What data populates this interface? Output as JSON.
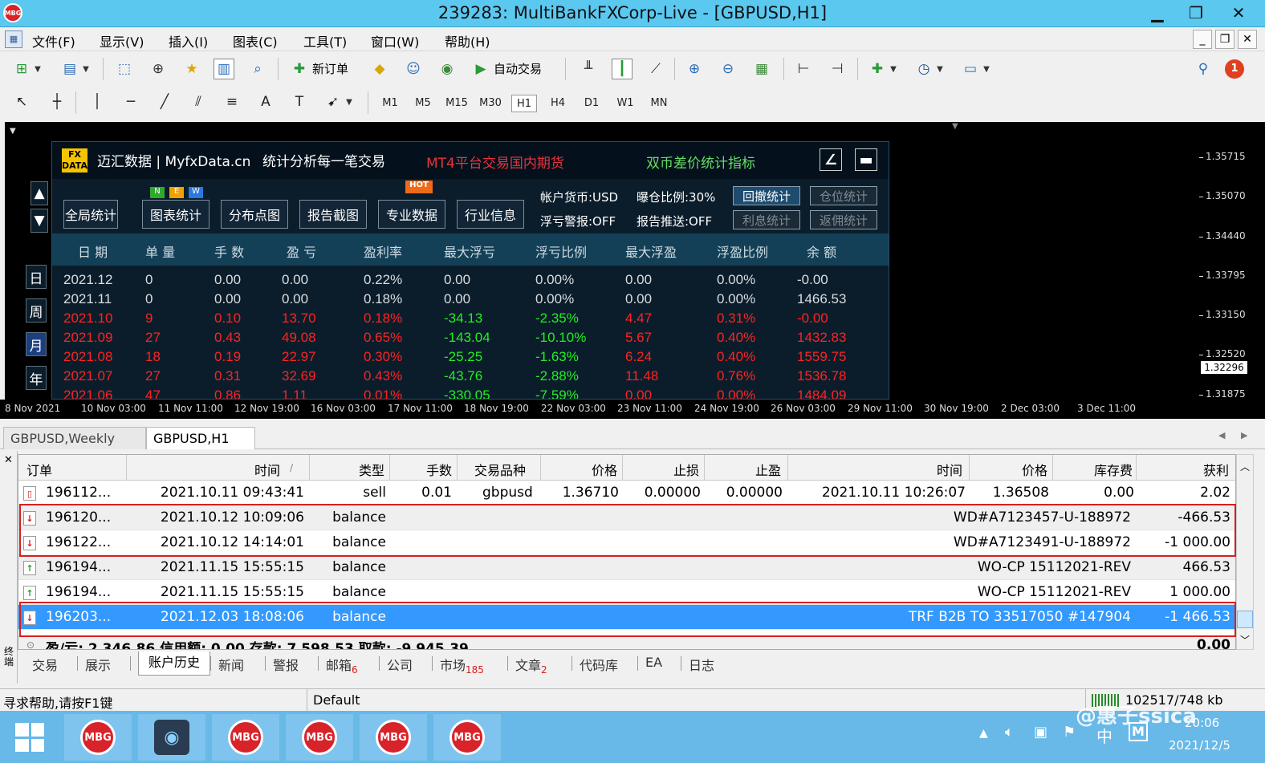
{
  "window": {
    "title": "239283: MultiBankFXCorp-Live - [GBPUSD,H1]",
    "logo_text": "MBG",
    "minimize": "▁",
    "restore": "❐",
    "close": "✕"
  },
  "menu": [
    "文件(F)",
    "显示(V)",
    "插入(I)",
    "图表(C)",
    "工具(T)",
    "窗口(W)",
    "帮助(H)"
  ],
  "mdi": {
    "minimize": "_",
    "restore": "❐",
    "close": "✕"
  },
  "toolbar": {
    "new_order": "新订单",
    "auto_trading": "自动交易",
    "notification_count": "1",
    "text_tool": "A",
    "timeframes": [
      "M1",
      "M5",
      "M15",
      "M30",
      "H1",
      "H4",
      "D1",
      "W1",
      "MN"
    ],
    "active_timeframe": "H1"
  },
  "chart": {
    "prices": [
      "1.35715",
      "1.35070",
      "1.34440",
      "1.33795",
      "1.33150",
      "1.32520",
      "1.32296",
      "1.31875"
    ],
    "current_price": "1.32296",
    "times": [
      "8 Nov 2021",
      "10 Nov 03:00",
      "11 Nov 11:00",
      "12 Nov 19:00",
      "16 Nov 03:00",
      "17 Nov 11:00",
      "18 Nov 19:00",
      "22 Nov 03:00",
      "23 Nov 11:00",
      "24 Nov 19:00",
      "26 Nov 03:00",
      "29 Nov 11:00",
      "30 Nov 19:00",
      "2 Dec 03:00",
      "3 Dec 11:00"
    ]
  },
  "panel": {
    "logo": "FX DATA",
    "brand": "迈汇数据 | MyfxData.cn",
    "slogan": "统计分析每一笔交易",
    "promo": "MT4平台交易国内期货",
    "indicator": "双币差价统计指标",
    "new_badge": [
      "N",
      "E",
      "W"
    ],
    "hot_badge": "HOT",
    "nav": [
      "全局统计",
      "图表统计",
      "分布点图",
      "报告截图",
      "专业数据",
      "行业信息"
    ],
    "settings": {
      "currency": "帐户货币:USD",
      "ratio": "曝仓比例:30%",
      "float_alert": "浮亏警报:OFF",
      "report_push": "报告推送:OFF"
    },
    "right_buttons": [
      "回撤统计",
      "仓位统计",
      "利息统计",
      "返佣统计"
    ],
    "side_buttons": [
      "日",
      "周",
      "月",
      "年"
    ],
    "columns": [
      "日 期",
      "单 量",
      "手 数",
      "盈 亏",
      "盈利率",
      "最大浮亏",
      "浮亏比例",
      "最大浮盈",
      "浮盈比例",
      "余 额"
    ],
    "rows": [
      [
        "2021.12",
        "0",
        "0.00",
        "0.00",
        "0.22%",
        "0.00",
        "0.00%",
        "0.00",
        "0.00%",
        "-0.00"
      ],
      [
        "2021.11",
        "0",
        "0.00",
        "0.00",
        "0.18%",
        "0.00",
        "0.00%",
        "0.00",
        "0.00%",
        "1466.53"
      ],
      [
        "2021.10",
        "9",
        "0.10",
        "13.70",
        "0.18%",
        "-34.13",
        "-2.35%",
        "4.47",
        "0.31%",
        "-0.00"
      ],
      [
        "2021.09",
        "27",
        "0.43",
        "49.08",
        "0.65%",
        "-143.04",
        "-10.10%",
        "5.67",
        "0.40%",
        "1432.83"
      ],
      [
        "2021.08",
        "18",
        "0.19",
        "22.97",
        "0.30%",
        "-25.25",
        "-1.63%",
        "6.24",
        "0.40%",
        "1559.75"
      ],
      [
        "2021.07",
        "27",
        "0.31",
        "32.69",
        "0.43%",
        "-43.76",
        "-2.88%",
        "11.48",
        "0.76%",
        "1536.78"
      ],
      [
        "2021.06",
        "47",
        "0.86",
        "1.11",
        "0.01%",
        "-330.05",
        "-7.59%",
        "0.00",
        "0.00%",
        "1484.09"
      ]
    ],
    "colors": {
      "row_white": "#d9dde0",
      "row_red": "#ff2222",
      "row_green": "#22ee22",
      "promo": "#e8333a",
      "indicator": "#66dd66"
    }
  },
  "chart_tabs": [
    "GBPUSD,Weekly",
    "GBPUSD,H1"
  ],
  "history": {
    "columns": [
      "订单",
      "时间",
      "类型",
      "手数",
      "交易品种",
      "价格",
      "止损",
      "止盈",
      "时间",
      "价格",
      "库存费",
      "获利"
    ],
    "sort_mark": "/",
    "trade": [
      "196112...",
      "2021.10.11 09:43:41",
      "sell",
      "0.01",
      "gbpusd",
      "1.36710",
      "0.00000",
      "0.00000",
      "2021.10.11 10:26:07",
      "1.36508",
      "0.00",
      "2.02"
    ],
    "balance_rows": [
      {
        "order": "196120...",
        "time": "2021.10.12 10:09:06",
        "type": "balance",
        "comment": "WD#A7123457-U-188972",
        "profit": "-466.53",
        "dir": "down"
      },
      {
        "order": "196122...",
        "time": "2021.10.12 14:14:01",
        "type": "balance",
        "comment": "WD#A7123491-U-188972",
        "profit": "-1 000.00",
        "dir": "down"
      },
      {
        "order": "196194...",
        "time": "2021.11.15 15:55:15",
        "type": "balance",
        "comment": "WO-CP 15112021-REV",
        "profit": "466.53",
        "dir": "up"
      },
      {
        "order": "196194...",
        "time": "2021.11.15 15:55:15",
        "type": "balance",
        "comment": "WO-CP 15112021-REV",
        "profit": "1 000.00",
        "dir": "up"
      },
      {
        "order": "196203...",
        "time": "2021.12.03 18:08:06",
        "type": "balance",
        "comment": "TRF B2B TO 33517050 #147904",
        "profit": "-1 466.53",
        "dir": "down"
      }
    ],
    "summary": "盈/亏: 2 346.86  信用额: 0.00  存款: 7 598.53  取款: -9 945.39",
    "summary_total": "0.00"
  },
  "bottom_tabs": [
    {
      "label": "交易",
      "count": ""
    },
    {
      "label": "展示",
      "count": ""
    },
    {
      "label": "账户历史",
      "count": ""
    },
    {
      "label": "新闻",
      "count": ""
    },
    {
      "label": "警报",
      "count": ""
    },
    {
      "label": "邮箱",
      "count": "6"
    },
    {
      "label": "公司",
      "count": ""
    },
    {
      "label": "市场",
      "count": "185"
    },
    {
      "label": "文章",
      "count": "2"
    },
    {
      "label": "代码库",
      "count": ""
    },
    {
      "label": "EA",
      "count": ""
    },
    {
      "label": "日志",
      "count": ""
    }
  ],
  "terminal_label": "终端",
  "status": {
    "help": "寻求帮助,请按F1键",
    "profile": "Default",
    "traffic": "102517/748 kb"
  },
  "taskbar": {
    "apps": [
      "MBG",
      "MBG",
      "MBG",
      "MBG",
      "MBG"
    ],
    "ime": "中",
    "time": "20:06",
    "date": "2021/12/5",
    "watermark": "@惠子ssica"
  }
}
